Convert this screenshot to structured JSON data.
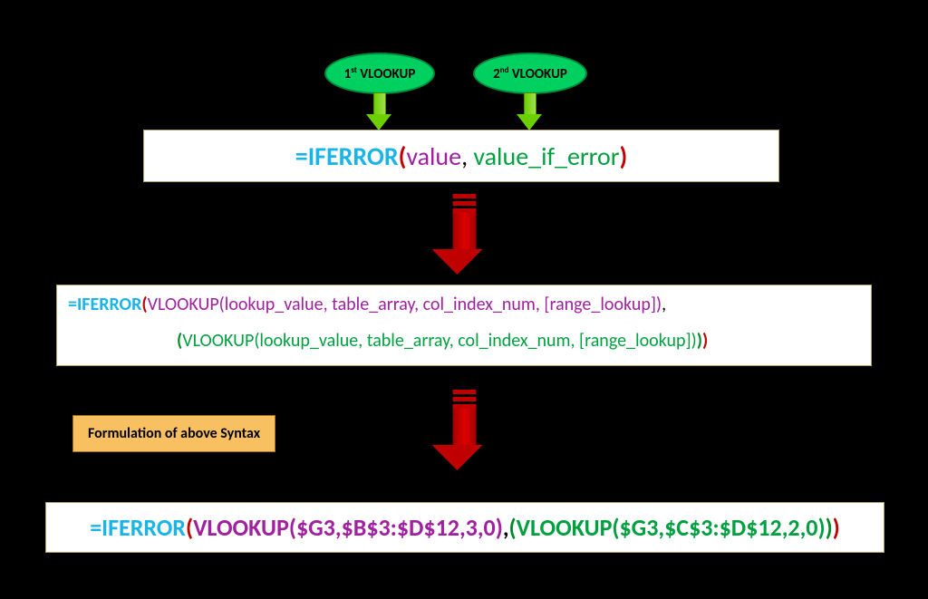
{
  "badges": {
    "b1_pre": "1",
    "b1_sup": "st",
    "b1_post": " VLOOKUP",
    "b2_pre": "2",
    "b2_sup": "nd",
    "b2_post": " VLOOKUP"
  },
  "formula1": {
    "eq": "=",
    "fn": "IFERROR",
    "open": "(",
    "arg1": "value",
    "comma": ", ",
    "arg2": "value_if_error",
    "close": ")"
  },
  "formula2": {
    "line1_eq": "=",
    "line1_fn": "IFERROR",
    "line1_open": "(",
    "line1_v": "VLOOKUP",
    "line1_args": "(lookup_value, table_array, col_index_num, [range_lookup])",
    "line1_end": ",",
    "line2_open": "(",
    "line2_v": "VLOOKUP",
    "line2_args": "(lookup_value, table_array, col_index_num, [range_lookup])",
    "line2_close1": ")",
    "line2_close2": ")"
  },
  "label": "Formulation of above Syntax",
  "formula3": {
    "eq": "=",
    "fn": "IFERROR",
    "open": "(",
    "v1": "VLOOKUP($G3,$B$3:$D$12,3,0)",
    "comma": ",",
    "open2": "(",
    "v2": "VLOOKUP($G3,$C$3:$D$12,2,0)",
    "close2": ")",
    "close1": ")"
  }
}
